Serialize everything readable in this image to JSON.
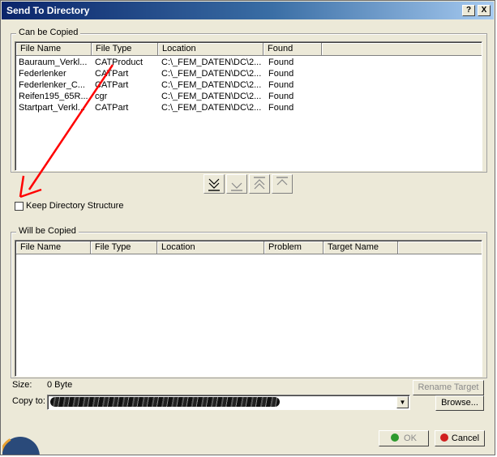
{
  "window": {
    "title": "Send To Directory",
    "help_icon": "?",
    "close_icon": "X"
  },
  "can_be_copied": {
    "label": "Can be Copied",
    "columns": [
      "File Name",
      "File Type",
      "Location",
      "Found"
    ],
    "rows": [
      [
        "Bauraum_Verkl...",
        "CATProduct",
        "C:\\_FEM_DATEN\\DC\\2...",
        "Found"
      ],
      [
        "Federlenker",
        "CATPart",
        "C:\\_FEM_DATEN\\DC\\2...",
        "Found"
      ],
      [
        "Federlenker_C...",
        "CATPart",
        "C:\\_FEM_DATEN\\DC\\2...",
        "Found"
      ],
      [
        "Reifen195_65R...",
        "cgr",
        "C:\\_FEM_DATEN\\DC\\2...",
        "Found"
      ],
      [
        "Startpart_Verkl...",
        "CATPart",
        "C:\\_FEM_DATEN\\DC\\2...",
        "Found"
      ]
    ]
  },
  "transfer_buttons": [
    "move-all-down-icon",
    "move-down-icon",
    "move-all-up-icon",
    "move-up-icon"
  ],
  "keep_structure": {
    "label": "Keep Directory Structure",
    "checked": false
  },
  "will_be_copied": {
    "label": "Will be Copied",
    "columns": [
      "File Name",
      "File Type",
      "Location",
      "Problem",
      "Target Name"
    ],
    "rows": []
  },
  "size": {
    "label": "Size:",
    "value": "0 Byte"
  },
  "rename_target_label": "Rename Target",
  "copy_to": {
    "label": "Copy to:"
  },
  "browse_label": "Browse...",
  "ok_label": "OK",
  "cancel_label": "Cancel",
  "colors": {
    "annotation_arrow": "#ff0000",
    "title_gradient_start": "#0a246a"
  }
}
